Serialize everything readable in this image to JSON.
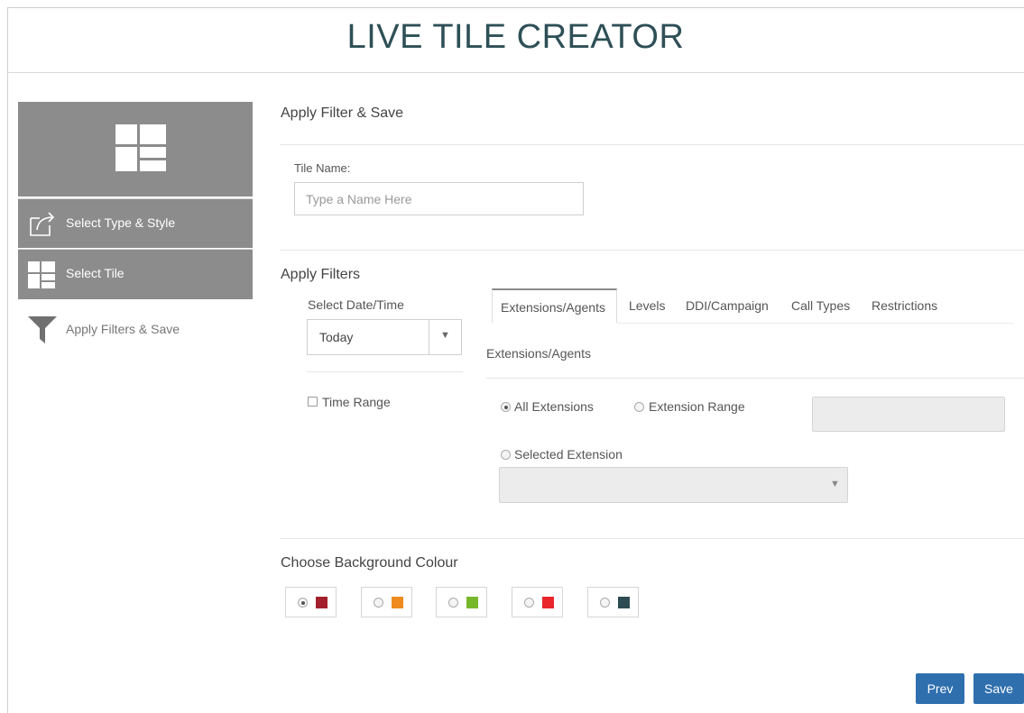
{
  "app": {
    "title": "LIVE TILE CREATOR"
  },
  "sidebar": {
    "items": [
      {
        "label": "Select Type & Style",
        "icon": "share-icon"
      },
      {
        "label": "Select Tile",
        "icon": "tile-icon"
      },
      {
        "label": "Apply Filters & Save",
        "icon": "funnel-icon"
      }
    ]
  },
  "main": {
    "section_title": "Apply Filter & Save",
    "tile_name": {
      "label": "Tile Name:",
      "placeholder": "Type a Name Here",
      "value": ""
    },
    "filters": {
      "title": "Apply Filters",
      "date_label": "Select Date/Time",
      "date_value": "Today",
      "time_range_label": "Time Range",
      "tabs": [
        "Extensions/Agents",
        "Levels",
        "DDI/Campaign",
        "Call Types",
        "Restrictions"
      ],
      "active_tab": "Extensions/Agents",
      "panel_title": "Extensions/Agents",
      "options": {
        "all": "All Extensions",
        "range": "Extension Range",
        "selected": "Selected Extension"
      },
      "selected_option": "All Extensions"
    },
    "background": {
      "title": "Choose Background Colour",
      "colors": [
        "#a31f2c",
        "#ee8a1e",
        "#76b82a",
        "#e8262c",
        "#2d4b52"
      ],
      "selected_index": 0
    }
  },
  "buttons": {
    "prev": "Prev",
    "save": "Save"
  }
}
